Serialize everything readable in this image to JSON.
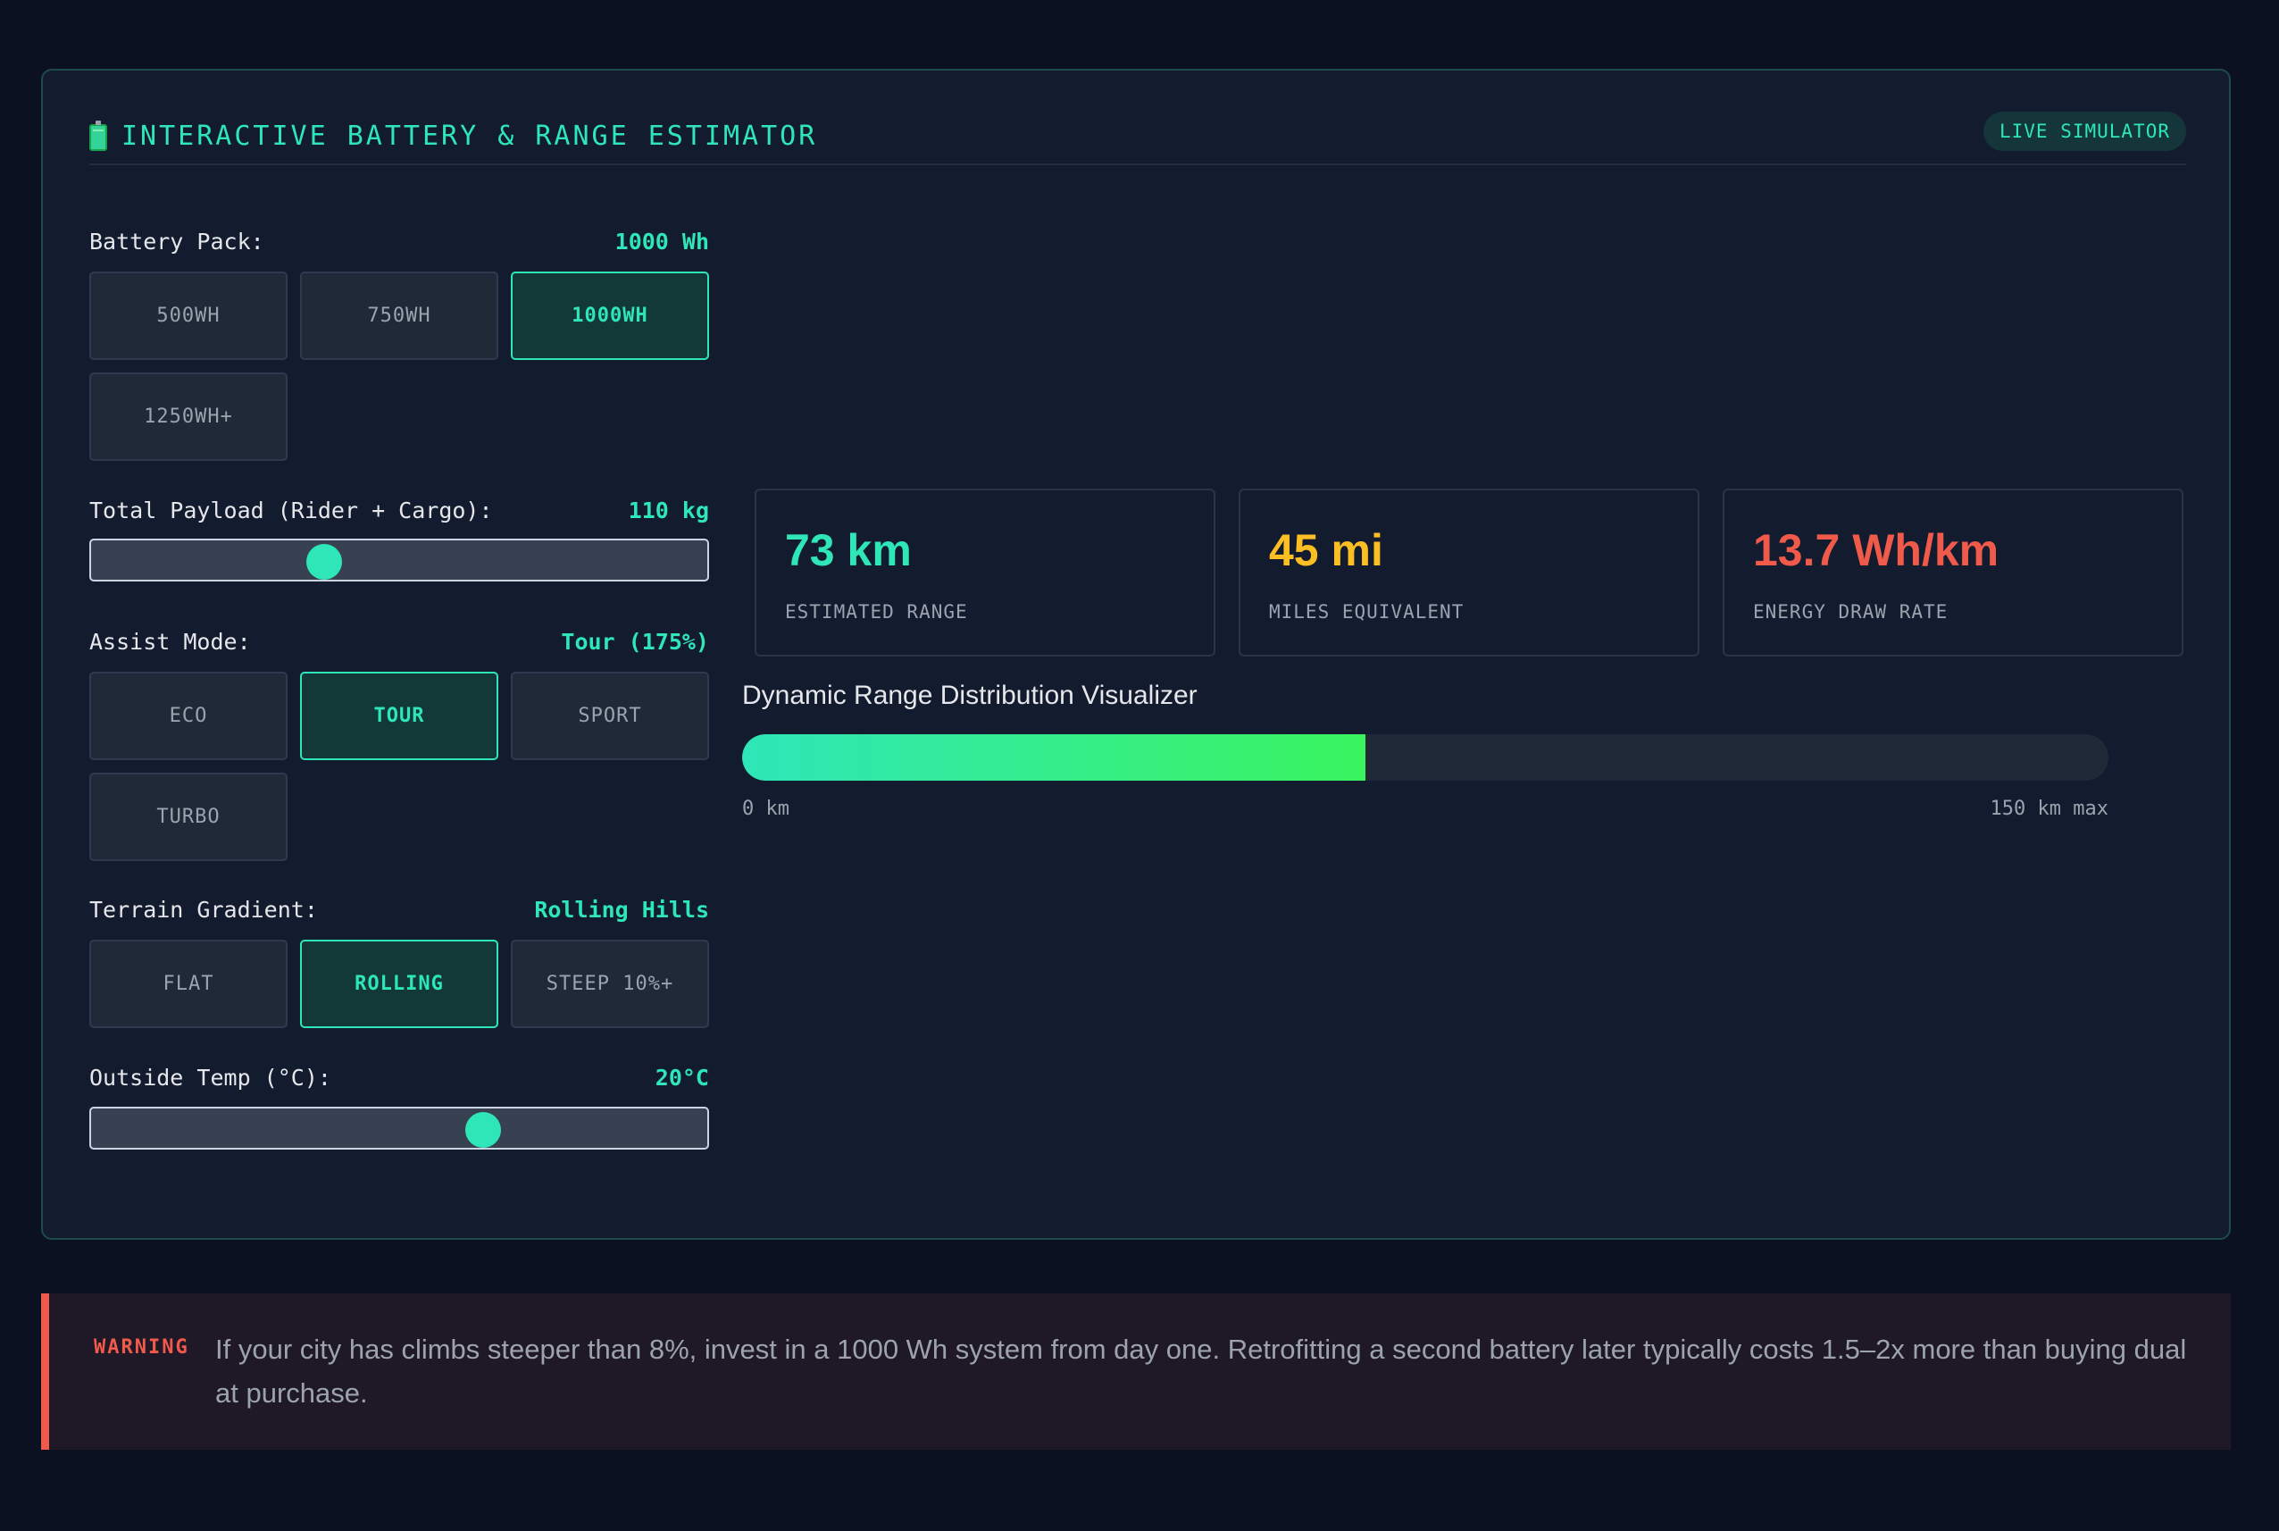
{
  "header": {
    "title": "INTERACTIVE BATTERY & RANGE ESTIMATOR",
    "badge": "LIVE SIMULATOR",
    "icon": "battery-icon"
  },
  "battery": {
    "label": "Battery Pack:",
    "value": "1000 Wh",
    "options": [
      "500WH",
      "750WH",
      "1000WH",
      "1250WH+"
    ],
    "selected": "1000WH"
  },
  "payload": {
    "label": "Total Payload (Rider + Cargo):",
    "value": "110 kg",
    "slider_fraction": 0.37
  },
  "assist": {
    "label": "Assist Mode:",
    "value": "Tour (175%)",
    "options": [
      "ECO",
      "TOUR",
      "SPORT",
      "TURBO"
    ],
    "selected": "TOUR"
  },
  "terrain": {
    "label": "Terrain Gradient:",
    "value": "Rolling Hills",
    "options": [
      "FLAT",
      "ROLLING",
      "STEEP 10%+"
    ],
    "selected": "ROLLING"
  },
  "temp": {
    "label": "Outside Temp (°C):",
    "value": "20°C",
    "slider_fraction": 0.645
  },
  "stats": [
    {
      "value": "73 km",
      "label": "ESTIMATED RANGE",
      "color": "#2ee6b8"
    },
    {
      "value": "45 mi",
      "label": "MILES EQUIVALENT",
      "color": "#fbbf24"
    },
    {
      "value": "13.7 Wh/km",
      "label": "ENERGY DRAW RATE",
      "color": "#f05a4a"
    }
  ],
  "visualizer": {
    "title": "Dynamic Range Distribution Visualizer",
    "min_label": "0 km",
    "max_label": "150 km max",
    "fill_fraction": 0.456
  },
  "warning": {
    "tag": "WARNING",
    "text": "If your city has climbs steeper than 8%, invest in a 1000 Wh system from day one. Retrofitting a second battery later typically costs 1.5–2x more than buying dual at purchase."
  },
  "colors": {
    "accent": "#2ee6b8",
    "warning": "#f05a4a",
    "miles": "#fbbf24"
  }
}
